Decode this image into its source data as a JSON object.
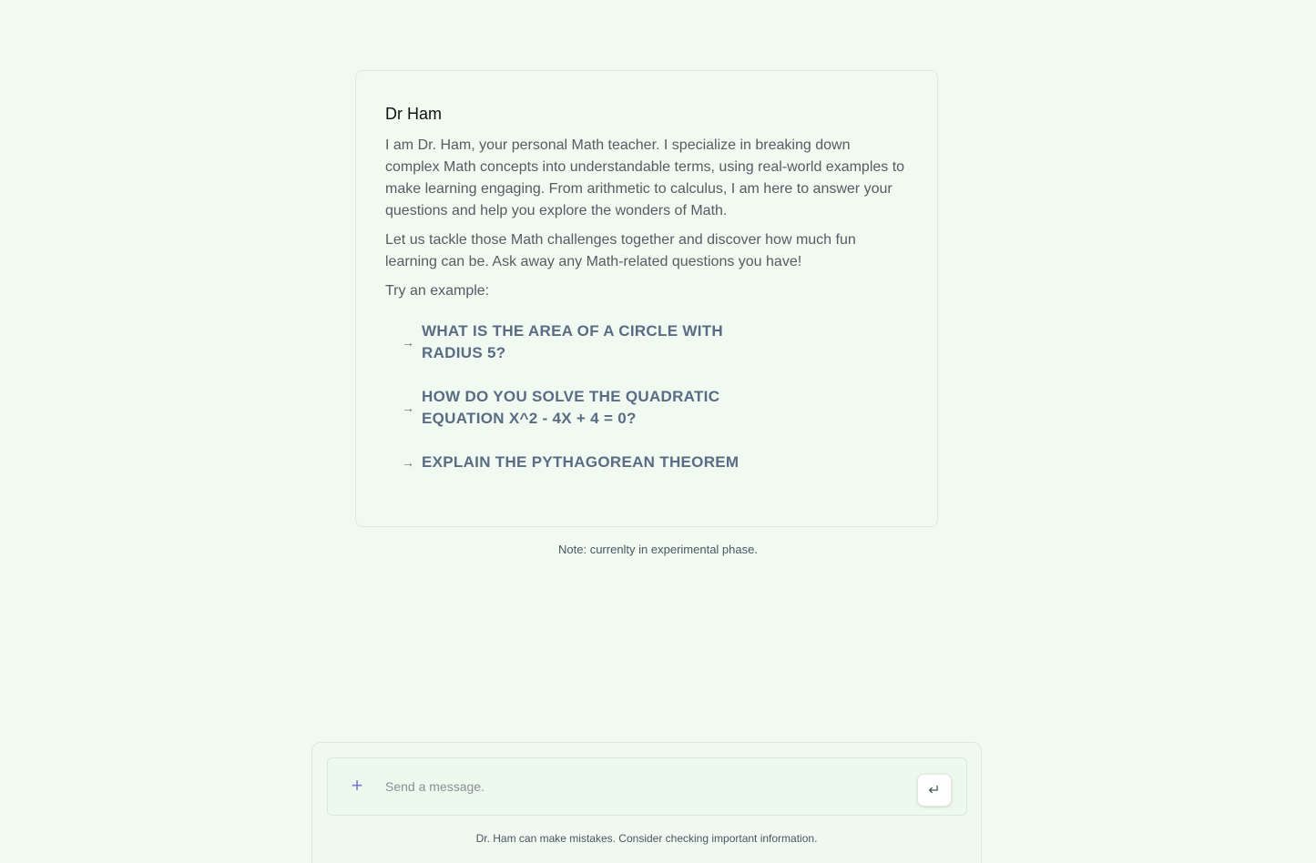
{
  "intro": {
    "title": "Dr Ham",
    "paragraphs": [
      "I am Dr. Ham, your personal Math teacher. I specialize in breaking down complex Math concepts into understandable terms, using real-world examples to make learning engaging. From arithmetic to calculus, I am here to answer your questions and help you explore the wonders of Math.",
      "Let us tackle those Math challenges together and discover how much fun learning can be. Ask away any Math-related questions you have!",
      "Try an example:"
    ],
    "examples": [
      {
        "arrow": "→",
        "label": "WHAT IS THE AREA OF A CIRCLE WITH RADIUS 5?"
      },
      {
        "arrow": "→",
        "label": "HOW DO YOU SOLVE THE QUADRATIC EQUATION X^2 - 4X + 4 = 0?"
      },
      {
        "arrow": "→",
        "label": "EXPLAIN THE PYTHAGOREAN THEOREM"
      }
    ]
  },
  "note": "Note: currenlty in experimental phase.",
  "composer": {
    "plus_icon": "+",
    "placeholder": "Send a message.",
    "send_icon": "↵",
    "disclaimer": "Dr. Ham can make mistakes. Consider checking important information."
  }
}
